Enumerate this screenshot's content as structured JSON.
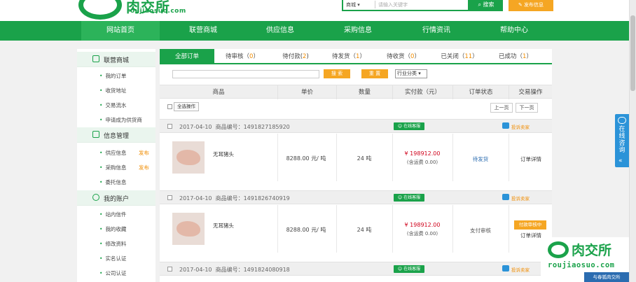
{
  "header": {
    "logo_text": "肉交所",
    "logo_domain": "roujiaosuo.com",
    "search_select": "商城",
    "search_placeholder": "请输入关键字",
    "search_button": "搜索",
    "post_button": "发布信息"
  },
  "nav": [
    "网站首页",
    "联营商城",
    "供应信息",
    "采购信息",
    "行情资讯",
    "帮助中心"
  ],
  "sidebar": {
    "sections": [
      {
        "title": "联营商城",
        "items": [
          "我的订单",
          "收货地址",
          "交易流水",
          "申请成为供货商"
        ]
      },
      {
        "title": "信息管理",
        "items": [
          "供应信息",
          "采购信息",
          "委托信息"
        ],
        "tags": [
          "发布",
          "发布"
        ]
      },
      {
        "title": "我的账户",
        "items": [
          "站内信件",
          "我的收藏",
          "修改资料",
          "实名认证",
          "公司认证"
        ]
      }
    ]
  },
  "tabs": [
    {
      "label": "全部订单",
      "count": ""
    },
    {
      "label": "待审核",
      "count": "0"
    },
    {
      "label": "待付款",
      "count": "2"
    },
    {
      "label": "待发货",
      "count": "1"
    },
    {
      "label": "待收货",
      "count": "0"
    },
    {
      "label": "已关闭",
      "count": "11"
    },
    {
      "label": "已成功",
      "count": "1"
    }
  ],
  "filter": {
    "search": "搜 索",
    "reset": "重 置",
    "category": "行业分类"
  },
  "columns": [
    "商品",
    "单价",
    "数量",
    "实付款（元）",
    "订单状态",
    "交易操作"
  ],
  "select_all": "全选操作",
  "pager": {
    "prev": "上一页",
    "next": "下一页"
  },
  "online_service": "在线客服",
  "report_seller": "投诉卖家",
  "orders": [
    {
      "date": "2017-04-10",
      "code_label": "商品编号：",
      "code": "1491827185920",
      "product": "无耳猪头",
      "price": "8288.00 元/ 吨",
      "qty": "24 吨",
      "amount": "¥ 198912.00",
      "freight": "(含运费 0.00)",
      "status": "待发货",
      "action": "订单详情"
    },
    {
      "date": "2017-04-10",
      "code_label": "商品编号：",
      "code": "1491826740919",
      "product": "无耳猪头",
      "price": "8288.00 元/ 吨",
      "qty": "24 吨",
      "amount": "¥ 198912.00",
      "freight": "(含运费 0.00)",
      "status": "支付审核",
      "confirm": "付款审核中",
      "action": "订单详情"
    },
    {
      "date": "2017-04-10",
      "code_label": "商品编号：",
      "code": "1491824080918"
    }
  ],
  "consult": {
    "text": "在线咨询",
    "arrow": "«"
  },
  "watermark": {
    "text": "肉交所",
    "domain": "roujiaosuo.com",
    "bar": "与春狐肉交所"
  },
  "colors": {
    "brand": "#1aa24a",
    "accent": "#f5a623",
    "price": "#d0021b",
    "link": "#2b93d8"
  }
}
